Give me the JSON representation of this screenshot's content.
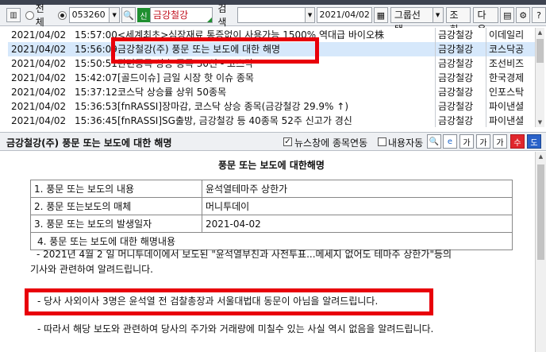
{
  "toolbar": {
    "radio_all": "전체",
    "stock_code": "053260",
    "sin_badge": "신",
    "stock_name": "금강철강",
    "search_label": "검색",
    "date": "2021/04/02",
    "group_button": "그룹선택",
    "query_button": "조회",
    "next_button": "다음"
  },
  "news_list": {
    "rows": [
      {
        "date": "2021/04/02",
        "time": "15:57:00",
        "title": "<세계최초>심장재료 통증없이 사용가능 1500% 역대급 바이오株",
        "name": "금강철강",
        "source": "이데일리"
      },
      {
        "date": "2021/04/02",
        "time": "15:56:09",
        "title": "금강철강(주) 풍문 또는 보도에 대한 해명",
        "name": "금강철강",
        "source": "코스닥공"
      },
      {
        "date": "2021/04/02",
        "time": "15:50:51",
        "title": "관련종목 상승 종목 30선 - 코스닥",
        "name": "금강철강",
        "source": "조선비즈"
      },
      {
        "date": "2021/04/02",
        "time": "15:42:07",
        "title": "[골드이슈] 금일 시장 핫 이슈 종목",
        "name": "금강철강",
        "source": "한국경제"
      },
      {
        "date": "2021/04/02",
        "time": "15:37:12",
        "title": "코스닥 상승률 상위 50종목",
        "name": "금강철강",
        "source": "인포스탁"
      },
      {
        "date": "2021/04/02",
        "time": "15:36:53",
        "title": "[fnRASSI]장마감, 코스닥 상승 종목(금강철강 29.9% ↑)",
        "name": "금강철강",
        "source": "파이낸셜"
      },
      {
        "date": "2021/04/02",
        "time": "15:36:45",
        "title": "[fnRASSI]SG출방, 금강철강 등 40종목 52주 신고가 경신",
        "name": "금강철강",
        "source": "파이낸셜"
      }
    ]
  },
  "viewer_header": {
    "title": "금강철강(주) 풍문 또는 보도에 대한 해명",
    "link_news_label": "뉴스창에 종목연동",
    "auto_content_label": "내용자동",
    "btn_text_up": "가",
    "btn_text_down": "가",
    "btn_text_size": "가",
    "btn_plus": "수",
    "btn_down": "도"
  },
  "article": {
    "title": "풍문 또는 보도에 대한해명",
    "table": [
      {
        "key": "1. 풍문 또는 보도의 내용",
        "value": "윤석열테마주 상한가"
      },
      {
        "key": "2. 풍문 또는보도의 매체",
        "value": "머니투데이"
      },
      {
        "key": "3. 풍문 또는 보도의 발생일자",
        "value": "2021-04-02"
      },
      {
        "key": "4. 풍문 또는 보도에 대한 해명내용",
        "value": ""
      }
    ],
    "para1_line1": "- 2021년 4월 2 일 머니투데이에서 보도된 \"윤석열부친과 사전투표...메세지 없어도 테마주 상한가\"등의",
    "para1_line2": "기사와 관련하여 알려드립니다.",
    "para2": "- 당사 사외이사 3명은 윤석열 전 검찰총장과 서울대법대 동문이 아님을 알려드립니다.",
    "para3": "- 따라서 해당 보도와 관련하여 당사의 주가와 거래량에 미칠수 있는 사실 역시 없음을 알려드립니다."
  }
}
